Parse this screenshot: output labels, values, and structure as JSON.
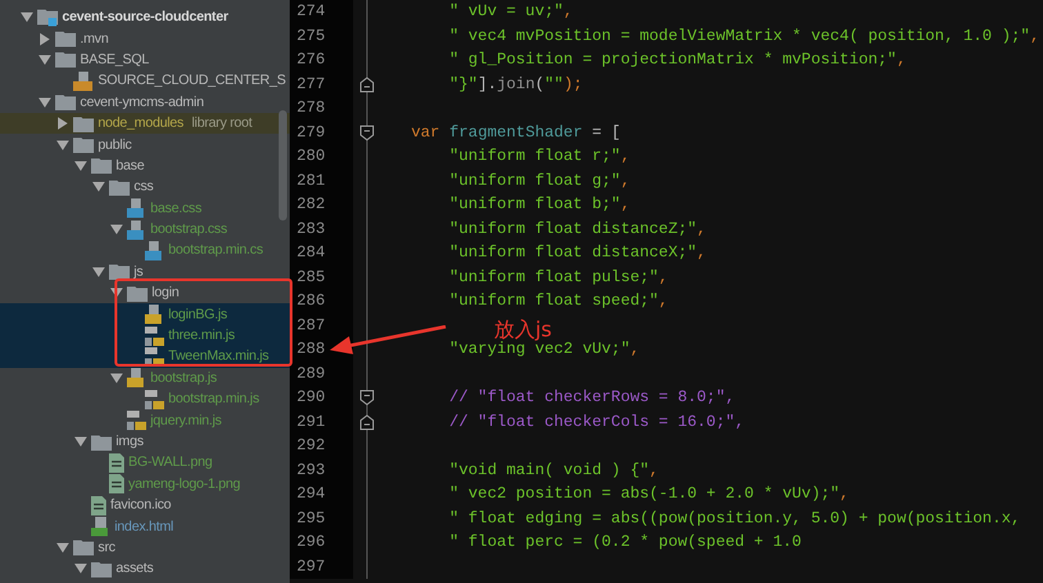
{
  "project_tree": [
    {
      "label": "cevent-source-cloudcenter",
      "kind": "module",
      "expanded": true,
      "selected": false,
      "excluded": false,
      "color": "#d8d8d8",
      "children": [
        {
          "label": ".mvn",
          "kind": "folder",
          "expanded": false,
          "selected": false,
          "excluded": false,
          "color": "#b8b8b8"
        },
        {
          "label": "BASE_SQL",
          "kind": "folder",
          "expanded": true,
          "selected": false,
          "excluded": false,
          "color": "#b8b8b8",
          "children": [
            {
              "label": "SOURCE_CLOUD_CENTER_S",
              "kind": "sql",
              "selected": false,
              "excluded": false,
              "color": "#b8b8b8"
            }
          ]
        },
        {
          "label": "cevent-ymcms-admin",
          "kind": "folder",
          "expanded": true,
          "selected": false,
          "excluded": false,
          "color": "#b8b8b8",
          "children": [
            {
              "label": "node_modules",
              "hint": "library root",
              "kind": "folder",
              "expanded": false,
              "selected": false,
              "excluded": true,
              "color": "#b3a64a"
            },
            {
              "label": "public",
              "kind": "folder",
              "expanded": true,
              "selected": false,
              "excluded": false,
              "color": "#b8b8b8",
              "children": [
                {
                  "label": "base",
                  "kind": "folder",
                  "expanded": true,
                  "selected": false,
                  "excluded": false,
                  "color": "#b8b8b8",
                  "children": [
                    {
                      "label": "css",
                      "kind": "folder",
                      "expanded": true,
                      "selected": false,
                      "excluded": false,
                      "color": "#b8b8b8",
                      "children": [
                        {
                          "label": "base.css",
                          "kind": "css",
                          "selected": false,
                          "excluded": false,
                          "color": "#5f9a4a"
                        },
                        {
                          "label": "bootstrap.css",
                          "kind": "css",
                          "expanded": true,
                          "selected": false,
                          "excluded": false,
                          "color": "#5f9a4a",
                          "children": [
                            {
                              "label": "bootstrap.min.cs",
                              "kind": "css",
                              "selected": false,
                              "excluded": false,
                              "color": "#5f9a4a"
                            }
                          ]
                        }
                      ]
                    },
                    {
                      "label": "js",
                      "kind": "folder",
                      "expanded": true,
                      "selected": false,
                      "excluded": false,
                      "color": "#b8b8b8",
                      "children": [
                        {
                          "label": "login",
                          "kind": "folder",
                          "expanded": true,
                          "selected": false,
                          "excluded": false,
                          "color": "#b8b8b8",
                          "children": [
                            {
                              "label": "loginBG.js",
                              "kind": "js",
                              "selected": true,
                              "excluded": false,
                              "color": "#5f9a4a"
                            },
                            {
                              "label": "three.min.js",
                              "kind": "jslib",
                              "selected": true,
                              "excluded": false,
                              "color": "#5f9a4a"
                            },
                            {
                              "label": "TweenMax.min.js",
                              "kind": "jslib",
                              "selected": true,
                              "excluded": false,
                              "color": "#5f9a4a"
                            }
                          ]
                        },
                        {
                          "label": "bootstrap.js",
                          "kind": "js",
                          "expanded": true,
                          "selected": false,
                          "excluded": false,
                          "color": "#5f9a4a",
                          "children": [
                            {
                              "label": "bootstrap.min.js",
                              "kind": "jslib",
                              "selected": false,
                              "excluded": false,
                              "color": "#5f9a4a"
                            }
                          ]
                        },
                        {
                          "label": "jquery.min.js",
                          "kind": "jslib",
                          "selected": false,
                          "excluded": false,
                          "color": "#5f9a4a"
                        }
                      ]
                    }
                  ]
                },
                {
                  "label": "imgs",
                  "kind": "folder",
                  "expanded": true,
                  "selected": false,
                  "excluded": false,
                  "color": "#b8b8b8",
                  "children": [
                    {
                      "label": "BG-WALL.png",
                      "kind": "image",
                      "selected": false,
                      "excluded": false,
                      "color": "#5f9a4a"
                    },
                    {
                      "label": "yameng-logo-1.png",
                      "kind": "image",
                      "selected": false,
                      "excluded": false,
                      "color": "#5f9a4a"
                    }
                  ]
                },
                {
                  "label": "favicon.ico",
                  "kind": "image",
                  "selected": false,
                  "excluded": false,
                  "color": "#b8b8b8"
                },
                {
                  "label": "index.html",
                  "kind": "html",
                  "selected": false,
                  "excluded": false,
                  "color": "#6897bb"
                }
              ]
            },
            {
              "label": "src",
              "kind": "folder",
              "expanded": true,
              "selected": false,
              "excluded": false,
              "color": "#b8b8b8",
              "children": [
                {
                  "label": "assets",
                  "kind": "folder",
                  "expanded": true,
                  "selected": false,
                  "excluded": false,
                  "color": "#b8b8b8"
                }
              ]
            }
          ]
        }
      ]
    }
  ],
  "annotation": {
    "label": "放入js"
  },
  "editor": {
    "lines": [
      {
        "number": "274",
        "indented": true,
        "tokens": [
          {
            "t": "\" vUv = uv;\"",
            "kind": "str"
          },
          {
            "t": ",",
            "kind": "punct"
          }
        ]
      },
      {
        "number": "275",
        "indented": true,
        "tokens": [
          {
            "t": "\" vec4 mvPosition = modelViewMatrix * vec4( position, 1.0 );\"",
            "kind": "str"
          },
          {
            "t": ",",
            "kind": "punct"
          }
        ]
      },
      {
        "number": "276",
        "indented": true,
        "tokens": [
          {
            "t": "\" gl_Position = projectionMatrix * mvPosition;\"",
            "kind": "str"
          },
          {
            "t": ",",
            "kind": "punct"
          }
        ]
      },
      {
        "number": "277",
        "indented": true,
        "kind": "foldend",
        "tokens": [
          {
            "t": "\"}\"",
            "kind": "str"
          },
          {
            "t": "].",
            "kind": "plain"
          },
          {
            "t": "join",
            "kind": "method"
          },
          {
            "t": "(",
            "kind": "plain"
          },
          {
            "t": "\"\"",
            "kind": "str"
          },
          {
            "t": ");",
            "kind": "punct"
          }
        ]
      },
      {
        "number": "278"
      },
      {
        "number": "279",
        "indented": false,
        "kind": "foldstart",
        "tokens": [
          {
            "t": "var",
            "kind": "kw"
          },
          {
            "t": " fragmentShader",
            "kind": "ident"
          },
          {
            "t": " = [",
            "kind": "plain"
          }
        ]
      },
      {
        "number": "280",
        "indented": true,
        "tokens": [
          {
            "t": "\"uniform float r;\"",
            "kind": "str"
          },
          {
            "t": ",",
            "kind": "punct"
          }
        ]
      },
      {
        "number": "281",
        "indented": true,
        "tokens": [
          {
            "t": "\"uniform float g;\"",
            "kind": "str"
          },
          {
            "t": ",",
            "kind": "punct"
          }
        ]
      },
      {
        "number": "282",
        "indented": true,
        "tokens": [
          {
            "t": "\"uniform float b;\"",
            "kind": "str"
          },
          {
            "t": ",",
            "kind": "punct"
          }
        ]
      },
      {
        "number": "283",
        "indented": true,
        "tokens": [
          {
            "t": "\"uniform float distanceZ;\"",
            "kind": "str"
          },
          {
            "t": ",",
            "kind": "punct"
          }
        ]
      },
      {
        "number": "284",
        "indented": true,
        "tokens": [
          {
            "t": "\"uniform float distanceX;\"",
            "kind": "str"
          },
          {
            "t": ",",
            "kind": "punct"
          }
        ]
      },
      {
        "number": "285",
        "indented": true,
        "tokens": [
          {
            "t": "\"uniform float pulse;\"",
            "kind": "str"
          },
          {
            "t": ",",
            "kind": "punct"
          }
        ]
      },
      {
        "number": "286",
        "indented": true,
        "tokens": [
          {
            "t": "\"uniform float speed;\"",
            "kind": "str"
          },
          {
            "t": ",",
            "kind": "punct"
          }
        ]
      },
      {
        "number": "287"
      },
      {
        "number": "288",
        "indented": true,
        "tokens": [
          {
            "t": "\"varying vec2 vUv;\"",
            "kind": "str"
          },
          {
            "t": ",",
            "kind": "punct"
          }
        ]
      },
      {
        "number": "289"
      },
      {
        "number": "290",
        "indented": true,
        "kind": "foldstart",
        "tokens": [
          {
            "t": "// \"float checkerRows = 8.0;\",",
            "kind": "comment"
          }
        ]
      },
      {
        "number": "291",
        "indented": true,
        "kind": "foldend",
        "tokens": [
          {
            "t": "// \"float checkerCols = 16.0;\",",
            "kind": "comment"
          }
        ]
      },
      {
        "number": "292"
      },
      {
        "number": "293",
        "indented": true,
        "tokens": [
          {
            "t": "\"void main( void ) {\"",
            "kind": "str"
          },
          {
            "t": ",",
            "kind": "punct"
          }
        ]
      },
      {
        "number": "294",
        "indented": true,
        "tokens": [
          {
            "t": "\" vec2 position = abs(-1.0 + 2.0 * vUv);\"",
            "kind": "str"
          },
          {
            "t": ",",
            "kind": "punct"
          }
        ]
      },
      {
        "number": "295",
        "indented": true,
        "tokens": [
          {
            "t": "\" float edging = abs((pow(position.y, 5.0) + pow(position.x,",
            "kind": "str"
          }
        ]
      },
      {
        "number": "296",
        "indented": true,
        "tokens": [
          {
            "t": "\" float perc = (0.2 * pow(speed + 1.0",
            "kind": "str"
          }
        ]
      },
      {
        "number": "297"
      }
    ]
  }
}
